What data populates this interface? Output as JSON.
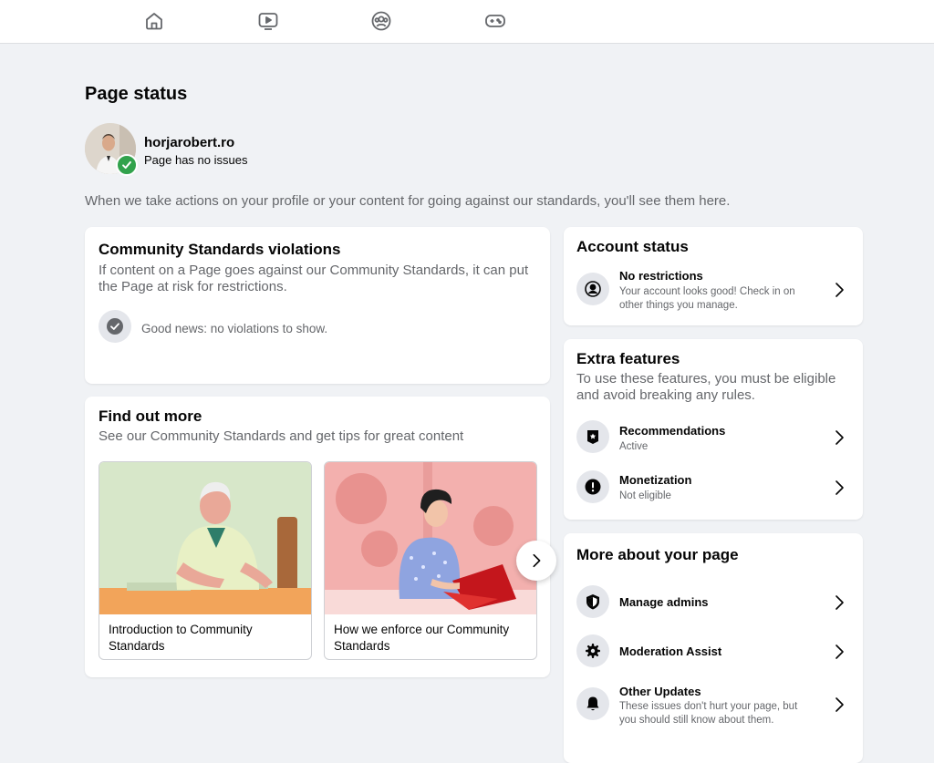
{
  "nav": {
    "icons": [
      "home-icon",
      "watch-icon",
      "groups-icon",
      "gaming-icon"
    ]
  },
  "page": {
    "title": "Page status",
    "intro": "When we take actions on your profile or your content for going against our standards, you'll see them here."
  },
  "profile": {
    "name": "horjarobert.ro",
    "status": "Page has no issues"
  },
  "violations": {
    "title": "Community Standards violations",
    "subtitle": "If content on a Page goes against our Community Standards, it can put the Page at risk for restrictions.",
    "good_news": "Good news: no violations to show."
  },
  "find_out_more": {
    "title": "Find out more",
    "subtitle": "See our Community Standards and get tips for great content",
    "cards": [
      {
        "caption": "Introduction to Community Standards"
      },
      {
        "caption": "How we enforce our Community Standards"
      }
    ]
  },
  "account_status": {
    "title": "Account status",
    "item": {
      "title": "No restrictions",
      "subtitle": "Your account looks good! Check in on other things you manage."
    }
  },
  "extra_features": {
    "title": "Extra features",
    "subtitle": "To use these features, you must be eligible and avoid breaking any rules.",
    "items": [
      {
        "title": "Recommendations",
        "subtitle": "Active"
      },
      {
        "title": "Monetization",
        "subtitle": "Not eligible"
      }
    ]
  },
  "more_about": {
    "title": "More about your page",
    "items": [
      {
        "title": "Manage admins"
      },
      {
        "title": "Moderation Assist"
      },
      {
        "title": "Other Updates",
        "subtitle": "These issues don't hurt your page, but you should still know about them."
      }
    ]
  },
  "colors": {
    "accent_green": "#31a24c",
    "background": "#f0f2f5",
    "secondary_text": "#65676b"
  }
}
